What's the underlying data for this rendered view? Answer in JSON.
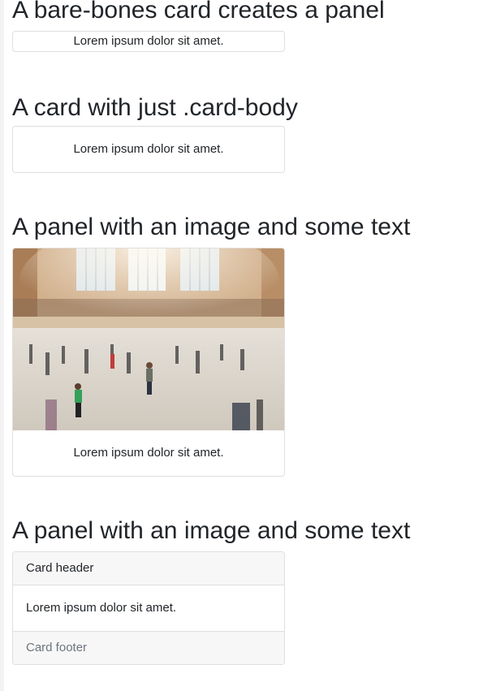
{
  "sections": [
    {
      "heading": "A bare-bones card creates a panel",
      "text": "Lorem ipsum dolor sit amet."
    },
    {
      "heading": "A card with just .card-body",
      "text": "Lorem ipsum dolor sit amet."
    },
    {
      "heading": "A panel with an image and some text",
      "text": "Lorem ipsum dolor sit amet."
    },
    {
      "heading": "A panel with an image and some text",
      "header": "Card header",
      "text": "Lorem ipsum dolor sit amet.",
      "footer": "Card footer"
    }
  ],
  "colors": {
    "border": "#dfdfdf",
    "cap_bg": "#f7f7f7",
    "muted": "#6c757d",
    "text": "#212529"
  }
}
